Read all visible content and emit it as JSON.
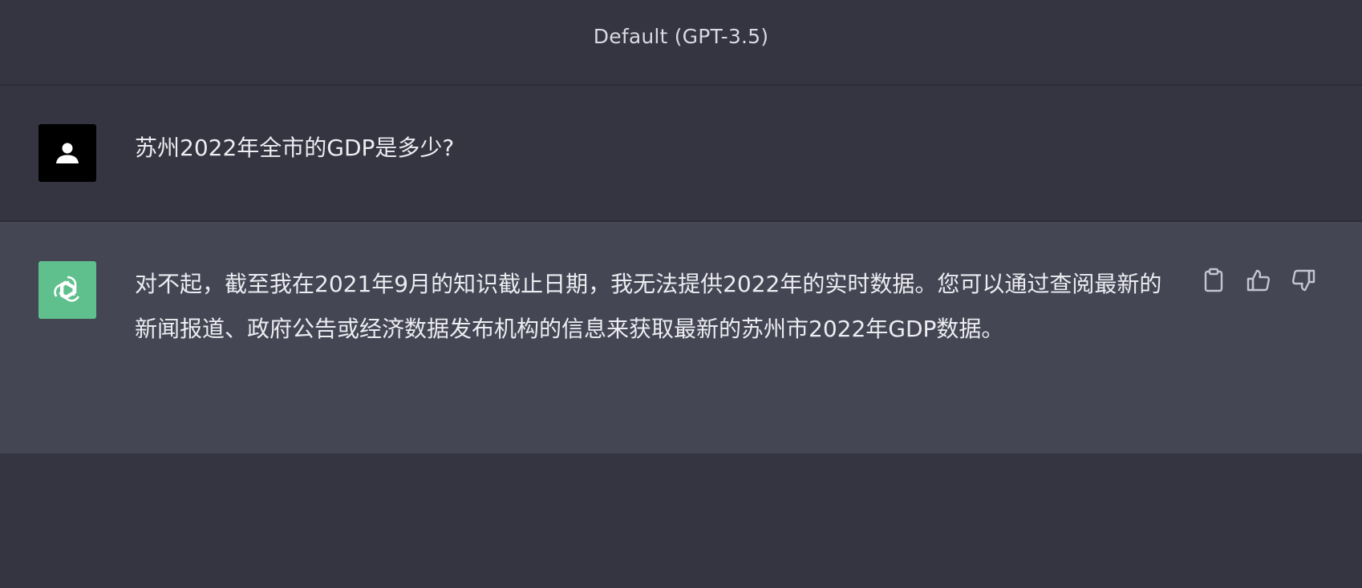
{
  "header": {
    "model_label": "Default (GPT-3.5)"
  },
  "conversation": {
    "user_message": {
      "avatar_icon": "user-silhouette-icon",
      "text": "苏州2022年全市的GDP是多少?"
    },
    "assistant_message": {
      "avatar_icon": "openai-logo-icon",
      "avatar_color": "#5fc08e",
      "text": "对不起，截至我在2021年9月的知识截止日期，我无法提供2022年的实时数据。您可以通过查阅最新的新闻报道、政府公告或经济数据发布机构的信息来获取最新的苏州市2022年GDP数据。",
      "actions": [
        {
          "icon": "clipboard-icon"
        },
        {
          "icon": "thumbs-up-icon"
        },
        {
          "icon": "thumbs-down-icon"
        }
      ]
    }
  },
  "colors": {
    "background": "#343541",
    "assistant_background": "#444654",
    "text": "#ececf1"
  }
}
